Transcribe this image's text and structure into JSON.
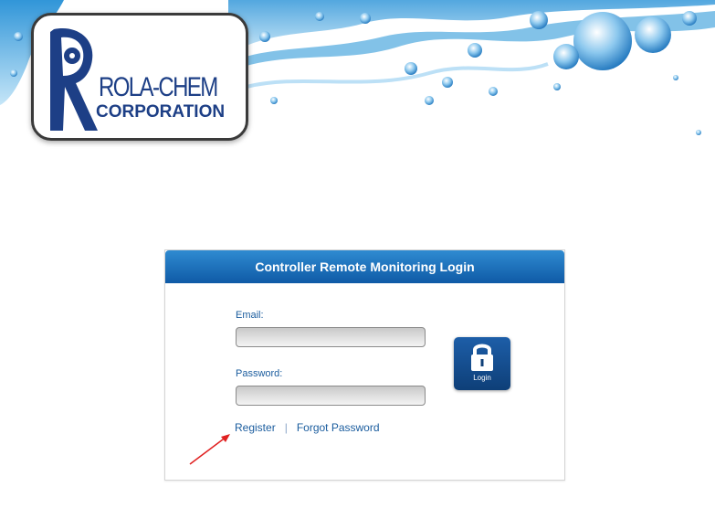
{
  "logo": {
    "wordmark": "ROLA-CHEM",
    "corporation": "CORPORATION"
  },
  "login_panel": {
    "title": "Controller Remote Monitoring Login",
    "email_label": "Email:",
    "email_value": "",
    "password_label": "Password:",
    "password_value": "",
    "login_button_label": "Login",
    "register_link": "Register",
    "separator": "|",
    "forgot_password_link": "Forgot Password"
  },
  "colors": {
    "header_blue": "#1a6fbe",
    "link_blue": "#1a5c9e",
    "logo_navy": "#1d3f86",
    "annotation_arrow": "#e02020"
  }
}
